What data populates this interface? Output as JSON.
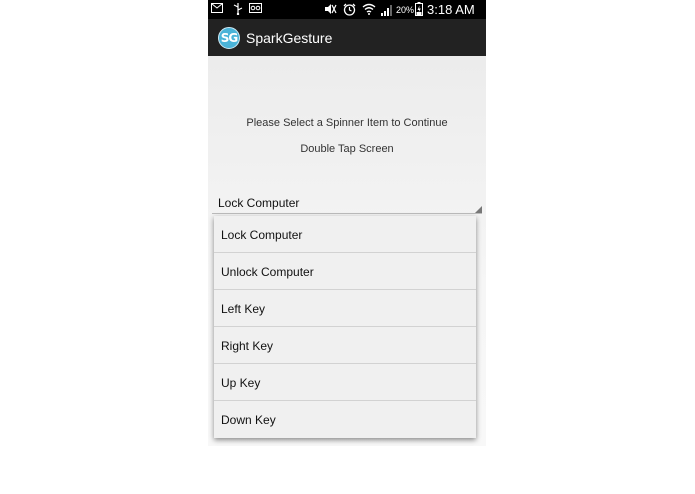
{
  "status_bar": {
    "battery_percent": "20%",
    "time": "3:18 AM",
    "icons_left": [
      "mail-icon",
      "usb-icon",
      "voicemail-icon"
    ],
    "icons_right": [
      "mute-icon",
      "alarm-icon",
      "wifi-icon",
      "signal-icon",
      "battery-icon"
    ]
  },
  "action_bar": {
    "logo_text": "SG",
    "title": "SparkGesture"
  },
  "main": {
    "instruction_1": "Please Select a Spinner Item to Continue",
    "instruction_2": "Double Tap Screen",
    "spinner": {
      "selected": "Lock Computer",
      "options": [
        "Lock Computer",
        "Unlock Computer",
        "Left Key",
        "Right Key",
        "Up Key",
        "Down Key"
      ]
    }
  },
  "colors": {
    "action_bar": "#222222",
    "status_bar": "#000000",
    "logo": "#4ab3d8"
  }
}
